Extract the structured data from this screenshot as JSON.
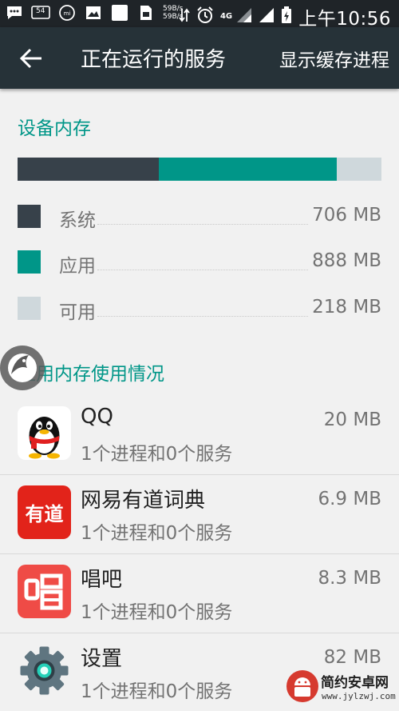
{
  "status_bar": {
    "time": "上午10:56",
    "net_speed_up": "59B/s",
    "net_speed_down": "59B/s",
    "network_type": "4G",
    "notif_badge": "54",
    "icons": [
      "message-icon",
      "notification-count-icon",
      "mi-icon",
      "image-icon",
      "square-icon",
      "sim-icon",
      "data-transfer-icon",
      "alarm-icon",
      "signal-icon",
      "signal-icon-2",
      "battery-charging-icon"
    ]
  },
  "app_bar": {
    "title": "正在运行的服务",
    "action": "显示缓存进程"
  },
  "device_memory": {
    "heading": "设备内存",
    "bar": [
      {
        "key": "system",
        "fraction": 0.389,
        "color": "#37414a"
      },
      {
        "key": "apps",
        "fraction": 0.489,
        "color": "#009688"
      },
      {
        "key": "free",
        "fraction": 0.122,
        "color": "#cfd8dc"
      }
    ],
    "legend": [
      {
        "label": "系统",
        "value": "706 MB",
        "color": "#37414a"
      },
      {
        "label": "应用",
        "value": "888 MB",
        "color": "#009688"
      },
      {
        "label": "可用",
        "value": "218 MB",
        "color": "#cfd8dc"
      }
    ]
  },
  "app_memory": {
    "heading": "应用内存使用情况",
    "apps": [
      {
        "name": "QQ",
        "sub": "1个进程和0个服务",
        "size": "20 MB",
        "icon": "qq-penguin-icon"
      },
      {
        "name": "网易有道词典",
        "sub": "1个进程和0个服务",
        "size": "6.9 MB",
        "icon": "youdao-dict-icon",
        "icon_text": "有道"
      },
      {
        "name": "唱吧",
        "sub": "1个进程和0个服务",
        "size": "8.3 MB",
        "icon": "changba-icon"
      },
      {
        "name": "设置",
        "sub": "1个进程和0个服务",
        "size": "82 MB",
        "icon": "settings-gear-icon"
      }
    ]
  },
  "watermark": {
    "name": "简约安卓网",
    "url": "www.jylzwj.com"
  }
}
